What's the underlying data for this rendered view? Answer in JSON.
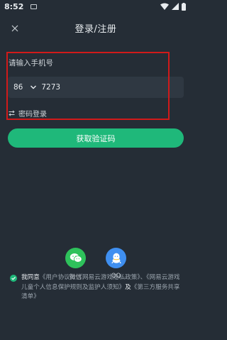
{
  "status_bar": {
    "time": "8:52"
  },
  "header": {
    "title": "登录/注册"
  },
  "form": {
    "phone_label": "请输入手机号",
    "country_code": "86",
    "phone_value": "7273",
    "password_login": "密码登录",
    "get_code_button": "获取验证码"
  },
  "social": {
    "wechat_label": "微信",
    "qq_label": "QQ"
  },
  "agreement": {
    "prefix": "我同意",
    "user_agreement": "《用户协议》",
    "sep1": "、",
    "privacy_policy": "《网易云游戏隐私政策》",
    "sep2": "、",
    "child_protection": "《网易云游戏儿童个人信息保护规则及监护人须知》",
    "and": "及",
    "third_party": "《第三方服务共享清单》"
  },
  "colors": {
    "background": "#252d36",
    "accent": "#1fb87a",
    "wechat": "#2ec15b",
    "qq": "#3f8ff0",
    "highlight": "#d11a1a"
  },
  "icons": [
    "close-icon",
    "chevron-down-icon",
    "swap-icon",
    "wechat-icon",
    "qq-icon",
    "check-icon",
    "wifi-icon",
    "signal-icon",
    "battery-icon"
  ]
}
